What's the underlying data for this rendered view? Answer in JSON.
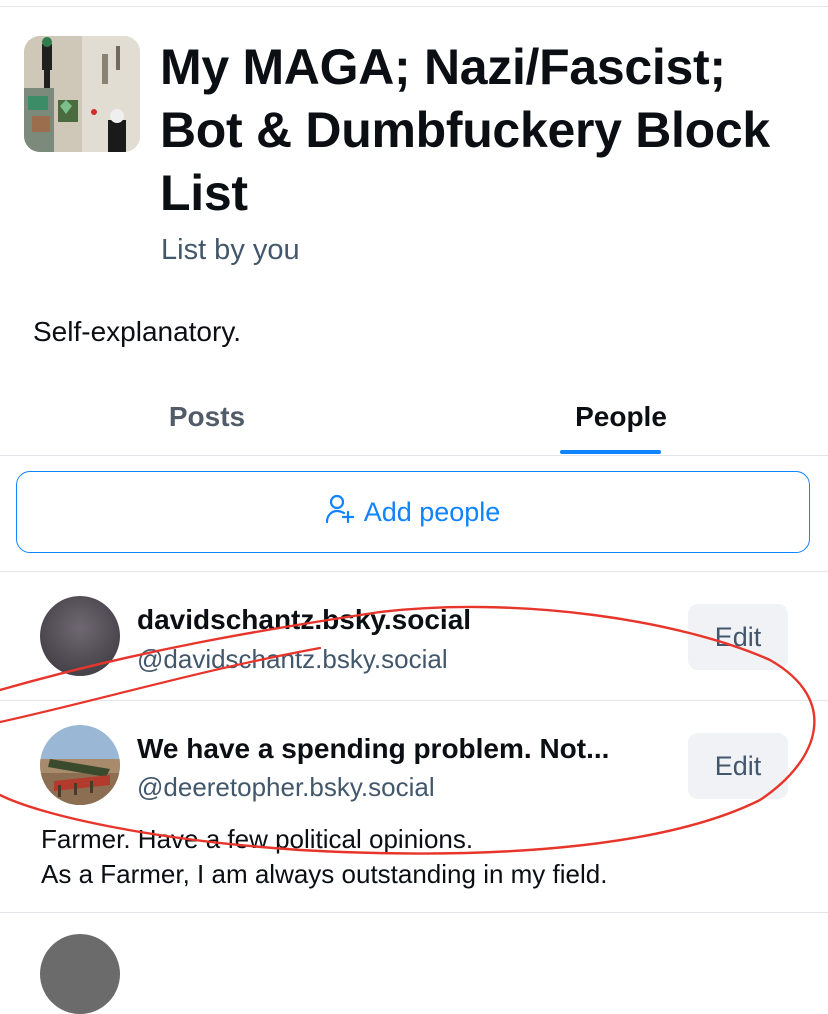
{
  "list": {
    "title": "My MAGA; Nazi/Fascist; Bot & Dumbfuckery Block List",
    "byline": "List by you",
    "description": "Self-explanatory."
  },
  "tabs": [
    {
      "label": "Posts",
      "active": false
    },
    {
      "label": "People",
      "active": true
    }
  ],
  "add_people": {
    "label": "Add people",
    "icon": "add-person-icon"
  },
  "members": [
    {
      "display_name": "davidschantz.bsky.social",
      "handle": "@davidschantz.bsky.social",
      "edit_label": "Edit"
    },
    {
      "display_name": "We have a spending problem. Not...",
      "handle": "@deeretopher.bsky.social",
      "edit_label": "Edit",
      "bio": [
        "Farmer. Have a few political opinions.",
        "As a Farmer, I am always outstanding in my field."
      ]
    }
  ],
  "colors": {
    "accent": "#1083fe",
    "annotation": "#e8352b",
    "muted_text": "#42576c"
  }
}
